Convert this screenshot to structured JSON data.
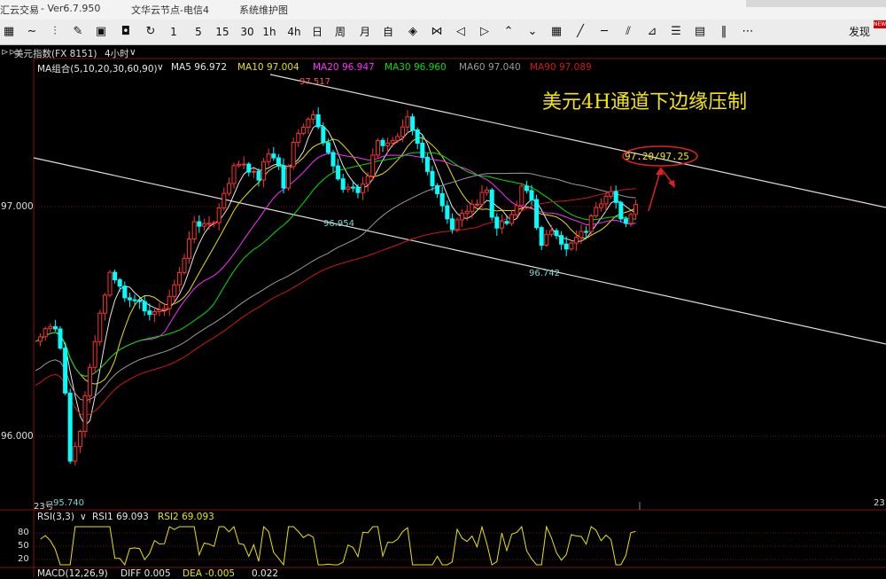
{
  "titlebar": {
    "app": "汇云交易",
    "version": "- Ver6.7.950",
    "node": "文华云节点-电信4",
    "hint": "系统维护图"
  },
  "toolbar": {
    "items": [
      "1",
      "5",
      "15",
      "30",
      "1h",
      "4h",
      "日",
      "周",
      "月",
      "自"
    ],
    "faxian": "发现",
    "badge": "NEW"
  },
  "chart_header": {
    "icon": "⊳⊳",
    "symbol": "美元指数(FX 8151)",
    "period": "4小时"
  },
  "ma_header": {
    "group": "MA组合(5,10,20,30,60,90)",
    "ma5": "MA5 96.972",
    "ma10": "MA10 97.004",
    "ma20": "MA20 96.947",
    "ma30": "MA30 96.960",
    "ma60": "MA60 97.040",
    "ma90": "MA90 97.089"
  },
  "colors": {
    "ma5": "#e6e6e6",
    "ma10": "#e8e000",
    "ma20": "#ff2bff",
    "ma30": "#00e000",
    "ma60": "#9a9a9a",
    "ma90": "#d21515",
    "up": "#ff3232",
    "down": "#00ffff",
    "channel": "#dcdcdc",
    "annotation": "#f6e600",
    "rsi": "#e6e600"
  },
  "price_axis": {
    "p97": "97.000",
    "p96": "96.000"
  },
  "extreme_labels": {
    "high": "97.517",
    "mid_low": "96.954",
    "low2": "96.742",
    "low": "95.740"
  },
  "time_labels": {
    "left": "23号",
    "right": "23"
  },
  "annotation": {
    "title": "美元4H通道下边缘压制",
    "target": "97.20/97.25"
  },
  "rsi": {
    "header": "RSI(3,3)",
    "rsi1": "RSI1 69.093",
    "rsi2": "RSI2 69.093",
    "levels": [
      "80",
      "50",
      "20"
    ]
  },
  "macd": {
    "header": "MACD(12,26,9)",
    "diff": "DIFF 0.005",
    "dea": "DEA -0.005",
    "macd": "0.022"
  }
}
